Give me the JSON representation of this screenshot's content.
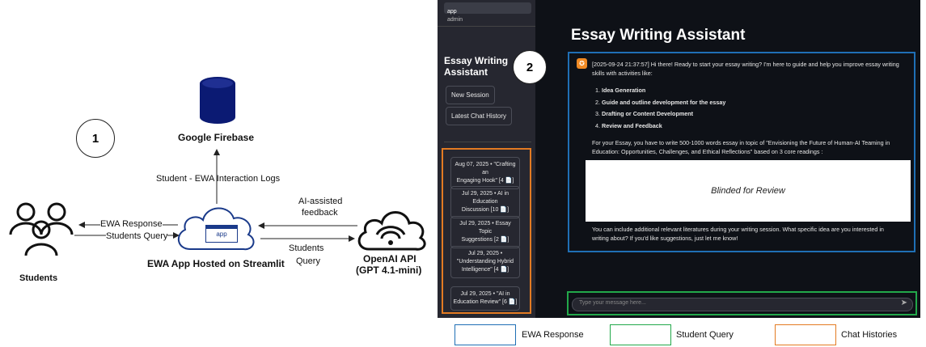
{
  "left_diagram": {
    "panel_number": "1",
    "firebase_label": "Google Firebase",
    "log_label": "Student - EWA Interaction Logs",
    "students_label": "Students",
    "ewa_response_label": "EWA Response",
    "students_query_label": "Students Query",
    "app_box_label": "app",
    "app_caption": "EWA App Hosted on Streamlit",
    "ai_feedback_label_1": "AI-assisted",
    "ai_feedback_label_2": "feedback",
    "query_to_api_label_1": "Students",
    "query_to_api_label_2": "Query",
    "openai_label_1": "OpenAI API",
    "openai_label_2": "(GPT 4.1-mini)"
  },
  "screenshot": {
    "panel_number": "2",
    "nav_items": [
      "app",
      "admin"
    ],
    "sidebar_title_1": "Essay Writing",
    "sidebar_title_2": "Assistant",
    "new_session_label": "New Session",
    "latest_history_label": "Latest Chat History",
    "histories": [
      {
        "line1": "Aug 07, 2025 • \"Crafting an",
        "line2": "Engaging Hook\" [4 📄]"
      },
      {
        "line1": "Jul 29, 2025 • AI in Education",
        "line2": "Discussion [10 📄]"
      },
      {
        "line1": "Jul 29, 2025 • Essay Topic",
        "line2": "Suggestions [2 📄]"
      },
      {
        "line1": "Jul 29, 2025 •",
        "line2": "\"Understanding Hybrid",
        "line3": "Intelligence\" [4 📄]"
      },
      {
        "line1": "Jul 29, 2025 • \"AI in",
        "line2": "Education Review\" [6 📄]"
      }
    ],
    "main_title": "Essay Writing Assistant",
    "greeting_1": "[2025-09-24 21:37:57] Hi there! Ready to start your essay writing? I'm here to guide and help you improve essay writing",
    "greeting_2": "skills with activities like:",
    "activities": [
      {
        "num": "1.",
        "text": "Idea Generation"
      },
      {
        "num": "2.",
        "text": "Guide and outline development for the essay"
      },
      {
        "num": "3.",
        "text": "Drafting or Content Development"
      },
      {
        "num": "4.",
        "text": "Review and Feedback"
      }
    ],
    "essay_1": "For your Essay, you have to write 500-1000 words essay in topic of \"Envisioning the Future of Human-AI Teaming in",
    "essay_2": "Education: Opportunities, Challenges, and Ethical Reflections\" based on 3 core readings :",
    "blinded_label": "Blinded for Review",
    "closing_1": "You can include additional relevant literatures during your writing session. What specific idea are you interested in",
    "closing_2": "writing about? If you'd like suggestions, just let me know!",
    "input_placeholder": "Type your message here..."
  },
  "legend": [
    {
      "label": "EWA Response",
      "color": "#1f6fb5"
    },
    {
      "label": "Student Query",
      "color": "#22a84a"
    },
    {
      "label": "Chat Histories",
      "color": "#e37b22"
    }
  ]
}
